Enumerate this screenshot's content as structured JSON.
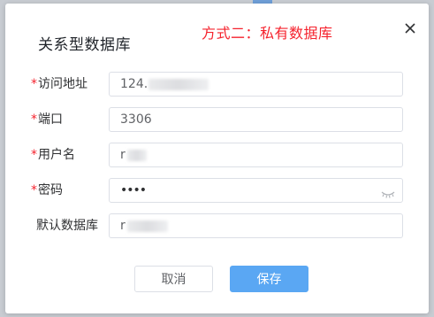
{
  "dialog": {
    "title": "关系型数据库",
    "note": "方式二：私有数据库",
    "note_color": "#f5222d",
    "close_icon": "close-icon"
  },
  "form": {
    "required_mark": "*",
    "address": {
      "label": "访问地址",
      "value": "124."
    },
    "port": {
      "label": "端口",
      "value": "3306"
    },
    "username": {
      "label": "用户名",
      "value": "r"
    },
    "password": {
      "label": "密码",
      "value": "••••",
      "icon": "eye-hidden-icon"
    },
    "default_db": {
      "label": "默认数据库",
      "value": "r"
    }
  },
  "buttons": {
    "cancel": "取消",
    "save": "保存",
    "save_color": "#5aa7f3"
  }
}
